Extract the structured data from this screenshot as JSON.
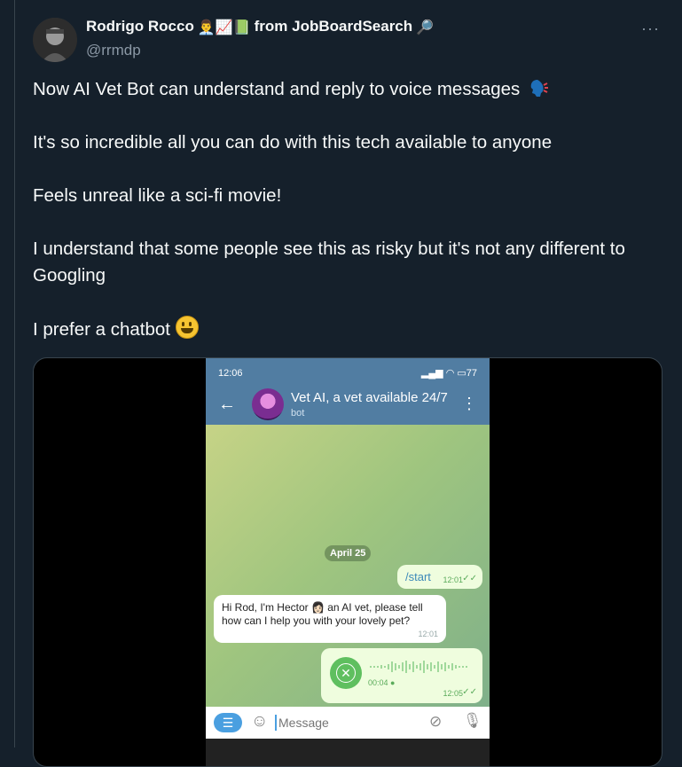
{
  "author": {
    "name": "Rodrigo Rocco",
    "name_emojis": "👨‍💼📈📗",
    "name_suffix": "from JobBoardSearch",
    "suffix_emoji": "🔎",
    "handle": "@rrmdp"
  },
  "tweet": {
    "line1": "Now AI Vet Bot can understand and reply to voice messages",
    "line2": "It's so incredible all you can do with this tech available to anyone",
    "line3": "Feels unreal like a sci-fi movie!",
    "line4": "I understand that some people see this as risky but it's not any different to Googling",
    "line5": "I prefer a chatbot"
  },
  "more_icon": "···",
  "phone": {
    "status_time": "12:06",
    "battery": "77",
    "chat_title": "Vet AI, a vet available 24/7",
    "chat_subtitle": "bot",
    "date_pill": "April 25",
    "msg_start": "/start",
    "msg_start_time": "12:01",
    "bot_msg": "Hi Rod, I'm Hector 👩🏻 an AI vet, please tell how can I help you with your lovely pet?",
    "bot_msg_time": "12:01",
    "voice_duration": "00:04",
    "voice_time": "12:05",
    "input_placeholder": "Message"
  }
}
